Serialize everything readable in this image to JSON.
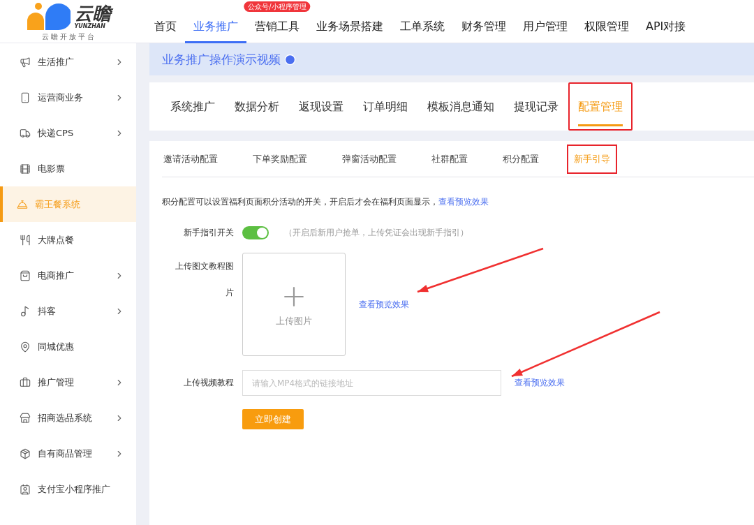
{
  "logo": {
    "name": "云瞻",
    "latin": "YUNZHAN",
    "tagline": "云 瞻 开 放 平 台"
  },
  "nav": [
    {
      "label": "首页",
      "selected": false
    },
    {
      "label": "业务推广",
      "selected": true
    },
    {
      "label": "营销工具",
      "selected": false,
      "badge": "公众号/小程序管理"
    },
    {
      "label": "业务场景搭建",
      "selected": false
    },
    {
      "label": "工单系统",
      "selected": false
    },
    {
      "label": "财务管理",
      "selected": false
    },
    {
      "label": "用户管理",
      "selected": false
    },
    {
      "label": "权限管理",
      "selected": false
    },
    {
      "label": "API对接",
      "selected": false
    }
  ],
  "sidebar": {
    "items": [
      {
        "label": "生活推广",
        "selected": false,
        "expandable": true
      },
      {
        "label": "运营商业务",
        "selected": false,
        "expandable": true
      },
      {
        "label": "快递CPS",
        "selected": false,
        "expandable": true
      },
      {
        "label": "电影票",
        "selected": false,
        "expandable": false
      },
      {
        "label": "霸王餐系统",
        "selected": true,
        "expandable": false
      },
      {
        "label": "大牌点餐",
        "selected": false,
        "expandable": false
      },
      {
        "label": "电商推广",
        "selected": false,
        "expandable": true
      },
      {
        "label": "抖客",
        "selected": false,
        "expandable": true
      },
      {
        "label": "同城优惠",
        "selected": false,
        "expandable": false
      },
      {
        "label": "推广管理",
        "selected": false,
        "expandable": true
      },
      {
        "label": "招商选品系统",
        "selected": false,
        "expandable": true
      },
      {
        "label": "自有商品管理",
        "selected": false,
        "expandable": true
      },
      {
        "label": "支付宝小程序推广",
        "selected": false,
        "expandable": false
      }
    ]
  },
  "banner": {
    "title": "业务推广操作演示视频"
  },
  "tabs": [
    {
      "label": "系统推广",
      "selected": false,
      "highlighted": false
    },
    {
      "label": "数据分析",
      "selected": false,
      "highlighted": false
    },
    {
      "label": "返现设置",
      "selected": false,
      "highlighted": false
    },
    {
      "label": "订单明细",
      "selected": false,
      "highlighted": false
    },
    {
      "label": "模板消息通知",
      "selected": false,
      "highlighted": false
    },
    {
      "label": "提现记录",
      "selected": false,
      "highlighted": false
    },
    {
      "label": "配置管理",
      "selected": true,
      "highlighted": true
    }
  ],
  "subtabs": [
    {
      "label": "邀请活动配置",
      "selected": false,
      "highlighted": false
    },
    {
      "label": "下单奖励配置",
      "selected": false,
      "highlighted": false
    },
    {
      "label": "弹窗活动配置",
      "selected": false,
      "highlighted": false
    },
    {
      "label": "社群配置",
      "selected": false,
      "highlighted": false
    },
    {
      "label": "积分配置",
      "selected": false,
      "highlighted": false
    },
    {
      "label": "新手引导",
      "selected": true,
      "highlighted": true
    }
  ],
  "form": {
    "description": "积分配置可以设置福利页面积分活动的开关，开启后才会在福利页面显示，",
    "description_link": "查看预览效果",
    "toggle": {
      "label": "新手指引开关",
      "on": true,
      "hint": "（开启后新用户抢单，上传凭证会出现新手指引）"
    },
    "image_upload": {
      "label_line1": "上传图文教程图",
      "label_line2": "片",
      "button": "上传图片",
      "link": "查看预览效果"
    },
    "video": {
      "label": "上传视频教程",
      "placeholder": "请输入MP4格式的链接地址",
      "link": "查看预览效果"
    },
    "submit": "立即创建"
  }
}
